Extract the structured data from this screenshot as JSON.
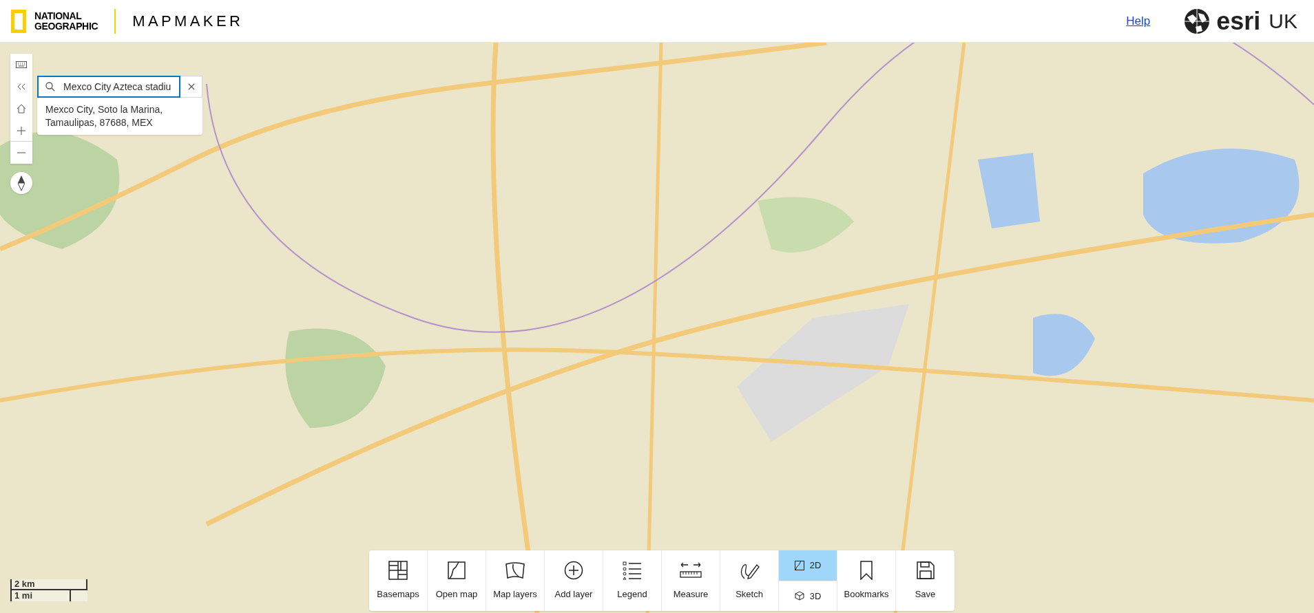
{
  "header": {
    "logo_lines": [
      "NATIONAL",
      "GEOGRAPHIC"
    ],
    "app_title": "MAPMAKER",
    "help_link": "Help",
    "brand": "esri",
    "brand_suffix": "UK"
  },
  "search": {
    "value": "Mexco City Azteca stadiu",
    "suggestions": [
      "Mexco City, Soto la Marina, Tamaulipas, 87688, MEX"
    ]
  },
  "toolbar": [
    {
      "kind": "button",
      "label": "Basemaps"
    },
    {
      "kind": "button",
      "label": "Open map"
    },
    {
      "kind": "button",
      "label": "Map layers"
    },
    {
      "kind": "button",
      "label": "Add layer"
    },
    {
      "kind": "button",
      "label": "Legend"
    },
    {
      "kind": "button",
      "label": "Measure"
    },
    {
      "kind": "button",
      "label": "Sketch"
    },
    {
      "kind": "toggle",
      "options": [
        {
          "label": "2D",
          "selected": true
        },
        {
          "label": "3D",
          "selected": false
        }
      ]
    },
    {
      "kind": "button",
      "label": "Bookmarks"
    },
    {
      "kind": "button",
      "label": "Save"
    }
  ],
  "scale_bar": {
    "metric": "2 km",
    "imperial": "1 mi"
  }
}
